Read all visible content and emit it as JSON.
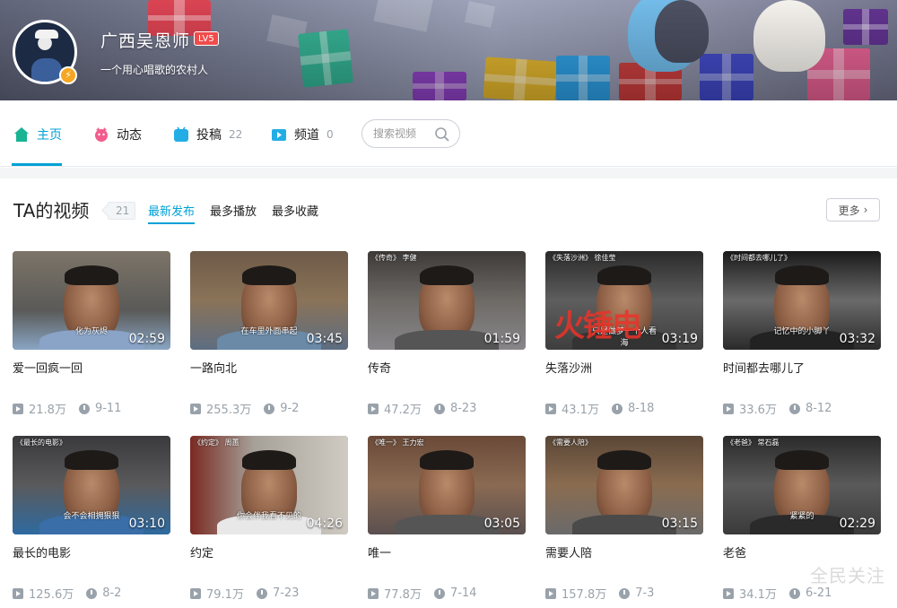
{
  "profile": {
    "name": "广西吴恩师",
    "level": "LV5",
    "sign": "一个用心唱歌的农村人"
  },
  "nav": {
    "items": [
      {
        "label": "主页",
        "count": "",
        "icon": "home-icon"
      },
      {
        "label": "动态",
        "count": "",
        "icon": "dynamic-icon"
      },
      {
        "label": "投稿",
        "count": "22",
        "icon": "upload-icon"
      },
      {
        "label": "频道",
        "count": "0",
        "icon": "channel-icon"
      }
    ],
    "search_placeholder": "搜索视频"
  },
  "section": {
    "title": "TA的视频",
    "count": "21",
    "orders": [
      "最新发布",
      "最多播放",
      "最多收藏"
    ],
    "more_label": "更多"
  },
  "accent_color": "#00a1d6",
  "videos": [
    {
      "title": "爱一回疯一回",
      "duration": "02:59",
      "views": "21.8万",
      "date": "9-11",
      "caption": "化为灰烬",
      "label": ""
    },
    {
      "title": "一路向北",
      "duration": "03:45",
      "views": "255.3万",
      "date": "9-2",
      "caption": "在车里外面串起",
      "label": ""
    },
    {
      "title": "传奇",
      "duration": "01:59",
      "views": "47.2万",
      "date": "8-23",
      "caption": "",
      "label": "《传奇》 李健"
    },
    {
      "title": "失落沙洲",
      "duration": "03:19",
      "views": "43.1万",
      "date": "8-18",
      "caption": "只是做梦一个人看海",
      "label": "《失落沙洲》 徐佳莹"
    },
    {
      "title": "时间都去哪儿了",
      "duration": "03:32",
      "views": "33.6万",
      "date": "8-12",
      "caption": "记忆中的小脚丫",
      "label": "《时间都去哪儿了》"
    },
    {
      "title": "最长的电影",
      "duration": "03:10",
      "views": "125.6万",
      "date": "8-2",
      "caption": "会不会相拥狠狠",
      "label": "《最长的电影》"
    },
    {
      "title": "约定",
      "duration": "04:26",
      "views": "79.1万",
      "date": "7-23",
      "caption": "你会伴我看不见的",
      "label": "《约定》 周蕙"
    },
    {
      "title": "唯一",
      "duration": "03:05",
      "views": "77.8万",
      "date": "7-14",
      "caption": "",
      "label": "《唯一》 王力宏"
    },
    {
      "title": "需要人陪",
      "duration": "03:15",
      "views": "157.8万",
      "date": "7-3",
      "caption": "",
      "label": "《需要人陪》"
    },
    {
      "title": "老爸",
      "duration": "02:29",
      "views": "34.1万",
      "date": "6-21",
      "caption": "紧紧的",
      "label": "《老爸》 常石磊"
    }
  ],
  "watermark_right": "全民关注",
  "watermark_thumb": "火锤电"
}
